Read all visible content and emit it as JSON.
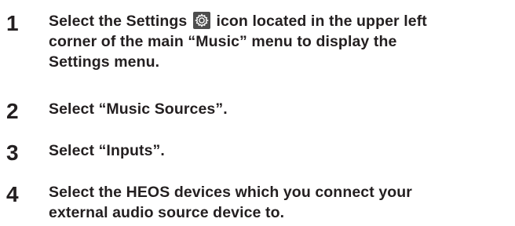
{
  "steps": [
    {
      "number": "1",
      "text_before_icon": "Select the Settings",
      "icon": "gear-icon",
      "text_after_icon_line1": "icon located in the upper left",
      "line2": "corner of the main “Music” menu to display the",
      "line3": "Settings menu."
    },
    {
      "number": "2",
      "text": "Select “Music Sources”."
    },
    {
      "number": "3",
      "text": "Select “Inputs”."
    },
    {
      "number": "4",
      "line1": "Select the HEOS devices which you connect your",
      "line2": "external audio source device to."
    }
  ],
  "colors": {
    "text": "#231f20",
    "icon_background": "#4d4d4d",
    "icon_foreground": "#ffffff"
  }
}
